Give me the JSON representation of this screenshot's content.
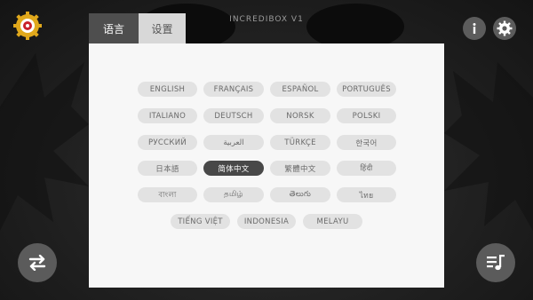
{
  "app": {
    "title": "INCREDIBOX V1"
  },
  "tabs": [
    {
      "label": "语言",
      "active": true
    },
    {
      "label": "设置",
      "active": false
    }
  ],
  "languages": {
    "selected": "简体中文",
    "rows": [
      [
        "ENGLISH",
        "FRANÇAIS",
        "ESPAÑOL",
        "PORTUGUÊS"
      ],
      [
        "ITALIANO",
        "DEUTSCH",
        "NORSK",
        "POLSKI"
      ],
      [
        "РУССКИЙ",
        "العربية",
        "TÜRKÇE",
        "한국어"
      ],
      [
        "日本語",
        "简体中文",
        "繁體中文",
        "हिंदी"
      ],
      [
        "বাংলা",
        "தமிழ்",
        "తెలుగు",
        "ไทย"
      ],
      [
        "TIẾNG VIỆT",
        "INDONESIA",
        "MELAYU"
      ]
    ]
  },
  "icons": {
    "logo": "incredibox-gear-logo-icon",
    "info": "info-icon",
    "settings": "gear-icon",
    "switch": "swap-arrows-icon",
    "playlist": "playlist-music-icon"
  },
  "colors": {
    "selected_bg": "#484848",
    "button_bg": "#e2e2e2",
    "logo_yellow": "#e0a81c",
    "logo_red": "#c8202a"
  }
}
